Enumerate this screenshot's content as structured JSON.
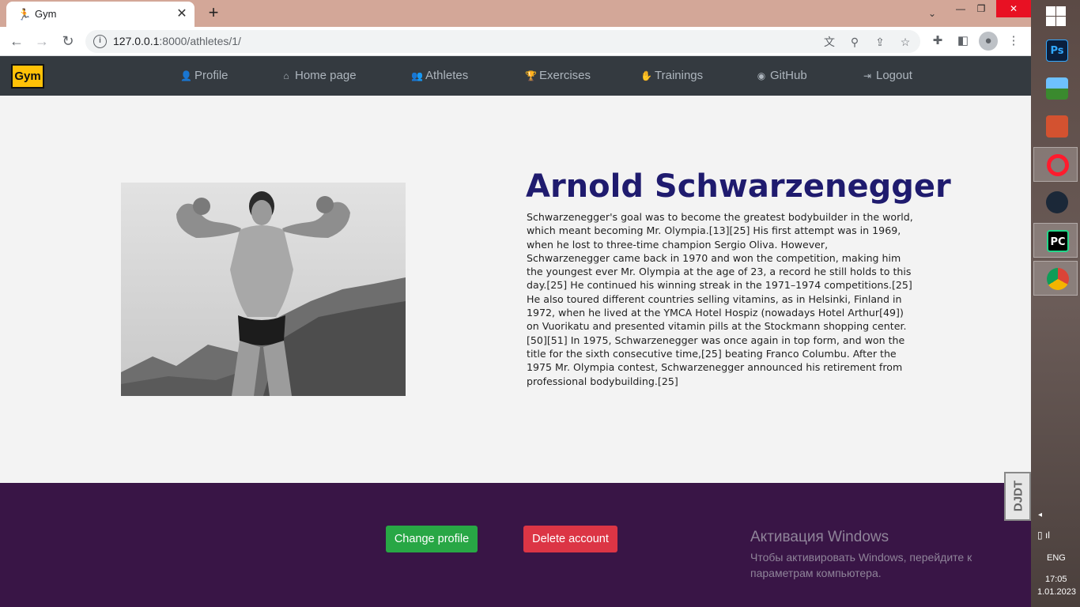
{
  "browser": {
    "tab_title": "Gym",
    "tab_icon": "running-man-icon",
    "url_host": "127.0.0.1",
    "url_path": ":8000/athletes/1/"
  },
  "site": {
    "brand": "Gym",
    "nav": [
      {
        "label": "Profile",
        "icon": "user-icon",
        "glyph": "👤"
      },
      {
        "label": "Home page",
        "icon": "home-icon",
        "glyph": "⌂"
      },
      {
        "label": "Athletes",
        "icon": "users-icon",
        "glyph": "👥"
      },
      {
        "label": "Exercises",
        "icon": "trophy-icon",
        "glyph": "🏆"
      },
      {
        "label": "Trainings",
        "icon": "hand-icon",
        "glyph": "✋"
      },
      {
        "label": "GitHub",
        "icon": "github-icon",
        "glyph": "◉"
      },
      {
        "label": "Logout",
        "icon": "logout-icon",
        "glyph": "⇥"
      }
    ],
    "colors": {
      "navbar": "#343a40",
      "brand": "#ffc107",
      "title": "#1f1b6e",
      "footer": "#391546",
      "btn_green": "#28a745",
      "btn_red": "#dc3545"
    }
  },
  "athlete": {
    "name": "Arnold Schwarzenegger",
    "photo": "bodybuilder-photo",
    "bio": "Schwarzenegger's goal was to become the greatest bodybuilder in the world, which meant becoming Mr. Olympia.[13][25] His first attempt was in 1969, when he lost to three-time champion Sergio Oliva. However, Schwarzenegger came back in 1970 and won the competition, making him the youngest ever Mr. Olympia at the age of 23, a record he still holds to this day.[25] He continued his winning streak in the 1971–1974 competitions.[25] He also toured different countries selling vitamins, as in Helsinki, Finland in 1972, when he lived at the YMCA Hotel Hospiz (nowadays Hotel Arthur[49]) on Vuorikatu and presented vitamin pills at the Stockmann shopping center.[50][51] In 1975, Schwarzenegger was once again in top form, and won the title for the sixth consecutive time,[25] beating Franco Columbu. After the 1975 Mr. Olympia contest, Schwarzenegger announced his retirement from professional bodybuilding.[25]"
  },
  "footer": {
    "change_label": "Change profile",
    "delete_label": "Delete account"
  },
  "activation": {
    "title": "Активация Windows",
    "text": "Чтобы активировать Windows, перейдите к параметрам компьютера."
  },
  "djdt": "DJDT",
  "taskbar": {
    "apps": [
      {
        "name": "photoshop",
        "label": "Ps"
      },
      {
        "name": "photos",
        "label": ""
      },
      {
        "name": "powerpoint",
        "label": ""
      },
      {
        "name": "opera",
        "label": "O"
      },
      {
        "name": "steam",
        "label": ""
      },
      {
        "name": "pycharm",
        "label": "PC"
      },
      {
        "name": "chrome",
        "label": ""
      }
    ],
    "lang": "ENG",
    "time": "17:05",
    "date": "1.01.2023"
  }
}
